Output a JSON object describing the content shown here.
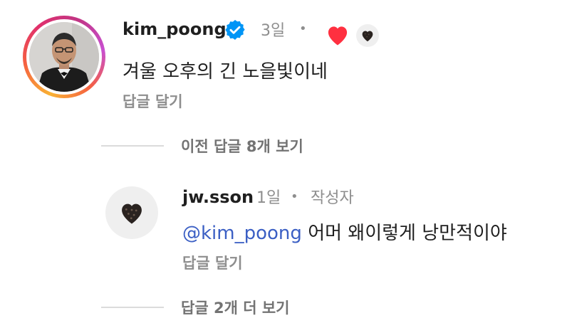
{
  "comment": {
    "username": "kim_poong",
    "verified_icon": "verified-badge-icon",
    "time": "3일",
    "separator": "•",
    "text": "겨울 오후의 긴 노을빛이네",
    "reply_label": "답글 달기",
    "liked_by_author": true,
    "heart_color": "#ff3040"
  },
  "view_previous": {
    "label": "이전 답글 8개 보기"
  },
  "reply": {
    "username": "jw.sson",
    "time": "1일",
    "separator": "•",
    "author_tag": "작성자",
    "mention": "@kim_poong",
    "text": "어머 왜이렇게 낭만적이야",
    "reply_label": "답글 달기"
  },
  "view_more": {
    "label": "답글 2개 더 보기"
  },
  "colors": {
    "accent_link": "#3b5fc4",
    "verified": "#0095f6",
    "muted": "#8e8e8e"
  }
}
